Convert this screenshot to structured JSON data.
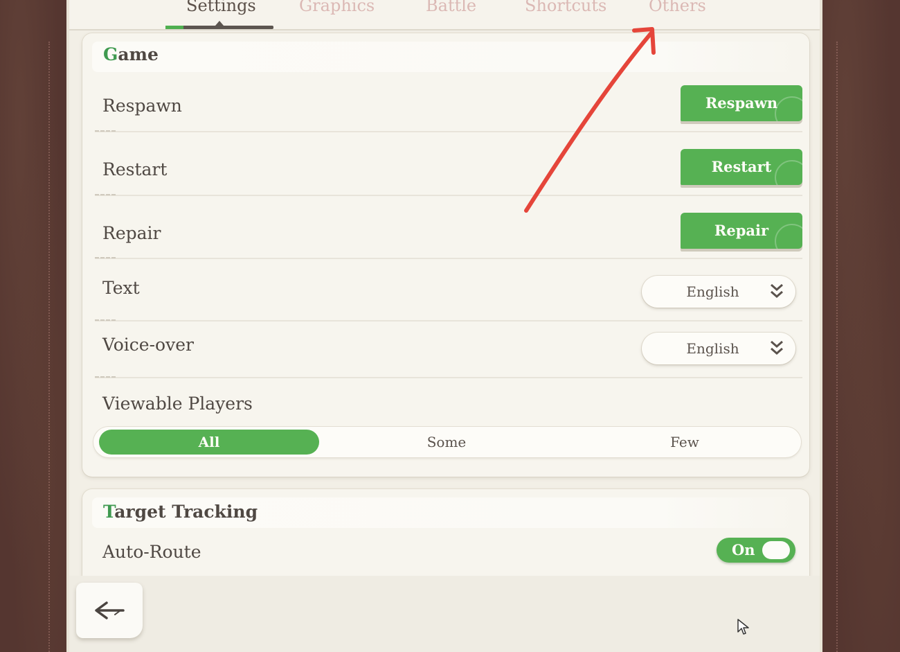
{
  "tabs": [
    {
      "label": "Settings",
      "active": true
    },
    {
      "label": "Graphics",
      "active": false
    },
    {
      "label": "Battle",
      "active": false
    },
    {
      "label": "Shortcuts",
      "active": false
    },
    {
      "label": "Others",
      "active": false
    }
  ],
  "game_section": {
    "title_initial": "G",
    "title_rest": "ame",
    "rows": {
      "respawn": {
        "label": "Respawn",
        "button": "Respawn"
      },
      "restart": {
        "label": "Restart",
        "button": "Restart"
      },
      "repair": {
        "label": "Repair",
        "button": "Repair"
      },
      "text": {
        "label": "Text",
        "value": "English"
      },
      "voice_over": {
        "label": "Voice-over",
        "value": "English"
      }
    },
    "viewable_players": {
      "label": "Viewable Players",
      "options": [
        "All",
        "Some",
        "Few"
      ],
      "selected": "All"
    }
  },
  "target_tracking": {
    "title_initial": "T",
    "title_rest": "arget Tracking",
    "auto_route": {
      "label": "Auto-Route",
      "state": "On"
    }
  },
  "icons": {
    "back": "back-arrow-icon",
    "dropdown": "double-chevron-down-icon",
    "cursor": "mouse-cursor-icon"
  },
  "colors": {
    "accent_green": "#56b153",
    "annotation_red": "#e5453a",
    "inactive_tab": "#dbb8b4"
  }
}
